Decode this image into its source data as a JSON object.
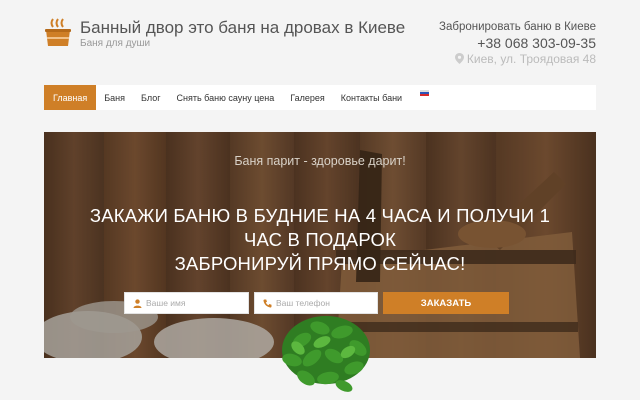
{
  "site": {
    "title": "Банный двор это баня на дровах в Киеве",
    "subtitle": "Баня для души",
    "logo_icon": "sauna-bucket-icon"
  },
  "contact": {
    "title": "Забронировать баню в Киеве",
    "phone": "+38 068 303-09-35",
    "address": "Киев, ул. Троядовая 48",
    "address_icon": "map-pin-icon"
  },
  "nav": {
    "items": [
      {
        "label": "Главная",
        "active": true
      },
      {
        "label": "Баня",
        "active": false
      },
      {
        "label": "Блог",
        "active": false
      },
      {
        "label": "Снять баню сауну цена",
        "active": false
      },
      {
        "label": "Галерея",
        "active": false
      },
      {
        "label": "Контакты бани",
        "active": false
      }
    ],
    "language_icon": "russian-flag-icon"
  },
  "hero": {
    "tagline": "Баня парит - здоровье дарит!",
    "heading_line1": "ЗАКАЖИ БАНЮ В БУДНИЕ НА 4 ЧАСА И ПОЛУЧИ 1",
    "heading_line2": "ЧАС В ПОДАРОК",
    "heading_line3": "ЗАБРОНИРУЙ ПРЯМО СЕЙЧАС!"
  },
  "form": {
    "name_placeholder": "Ваше имя",
    "phone_placeholder": "Ваш телефон",
    "submit_label": "ЗАКАЗАТЬ",
    "name_icon": "user-icon",
    "phone_icon": "phone-icon"
  },
  "colors": {
    "accent": "#cf7f27",
    "header_bg": "#f4f4f4",
    "text": "#555555"
  }
}
